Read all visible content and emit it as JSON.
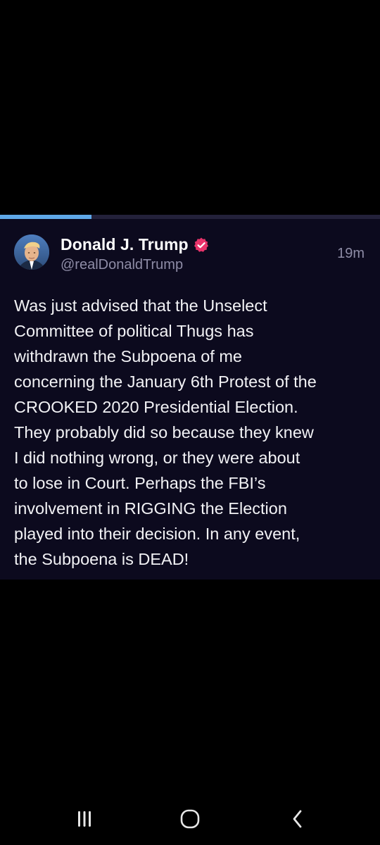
{
  "post": {
    "display_name": "Donald J. Trump",
    "handle": "@realDonaldTrump",
    "timestamp": "19m",
    "verified_icon": "verified-badge-icon",
    "accent_color": "#e8336a",
    "progress_fraction": 0.24,
    "body_lines": [
      "Was just advised that the Unselect",
      "Committee of political Thugs has",
      "withdrawn the Subpoena of me",
      "concerning the January 6th Protest of the",
      "CROOKED 2020 Presidential Election.",
      "They probably did so because they knew",
      "I did nothing wrong, or they were about",
      "to lose in Court. Perhaps the FBI’s",
      "involvement in RIGGING the Election",
      "played into their decision. In any event,",
      "the Subpoena is DEAD!"
    ]
  },
  "navigation": {
    "recents_icon": "recent-apps-icon",
    "home_icon": "home-circle-icon",
    "back_icon": "back-chevron-icon"
  }
}
